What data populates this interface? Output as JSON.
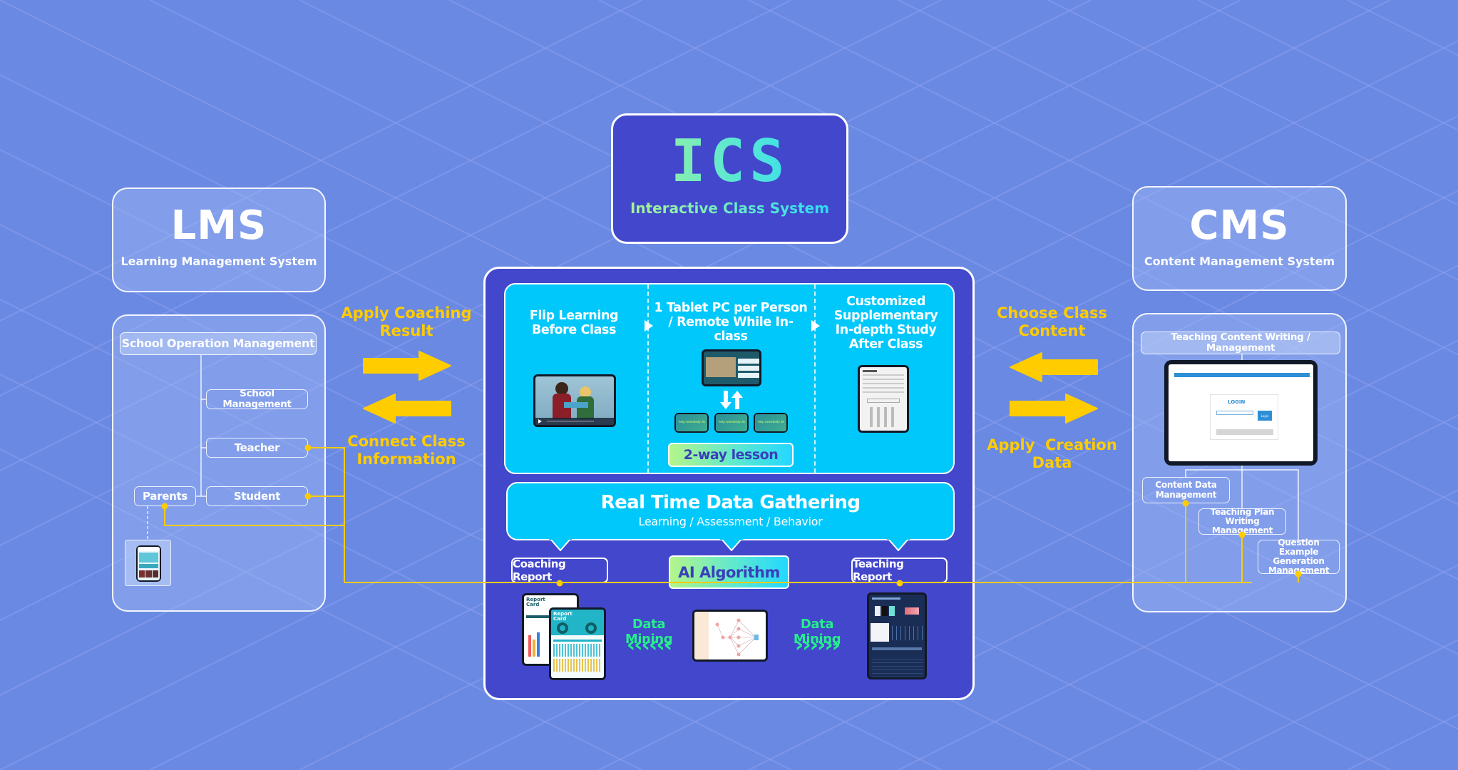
{
  "ics": {
    "title": "ICS",
    "subtitle": "Interactive Class System"
  },
  "lms": {
    "title": "LMS",
    "subtitle": "Learning Management System",
    "root_node": "School Operation Management",
    "nodes": {
      "school_management": "School Management",
      "teacher": "Teacher",
      "student": "Student",
      "parents": "Parents"
    }
  },
  "cms": {
    "title": "CMS",
    "subtitle": "Content Management System",
    "root_node": "Teaching Content Writing / Management",
    "nodes": {
      "content_data": "Content Data Management",
      "teaching_plan": "Teaching Plan Writing Management",
      "question_example": "Question Example Generation Management"
    },
    "login_screen": {
      "heading": "LOGIN",
      "button": "Login"
    }
  },
  "flows": {
    "left_top": "Apply Coaching Result",
    "left_bottom": "Connect Class Information",
    "right_top": "Choose Class Content",
    "right_bottom": "Apply  Creation Data"
  },
  "class_stages": [
    {
      "label": "Flip Learning Before Class"
    },
    {
      "label": "1 Tablet PC per Person / Remote While In-class"
    },
    {
      "label": "Customized Supplementary In-depth Study After Class"
    }
  ],
  "two_way_lesson": "2-way lesson",
  "tablet_prompt": "help somebody do",
  "data_gathering": {
    "title": "Real Time Data Gathering",
    "subtitle": "Learning / Assessment / Behavior"
  },
  "reports": {
    "coaching": "Coaching Report",
    "teaching": "Teaching Report",
    "ai": "AI Algorithm",
    "report_card": "Report Card"
  },
  "data_mining": {
    "left_label": "Data Mining",
    "right_label": "Data Mining",
    "left_chevrons": "‹‹‹‹‹‹",
    "right_chevrons": "››››››"
  },
  "colors": {
    "background": "#6a89e2",
    "panel_dark": "#4347cc",
    "cyan": "#00c8fb",
    "yellow": "#ffcc00",
    "green": "#25ef8a",
    "gradient_start": "#b4f58a",
    "gradient_end": "#22d8ff"
  }
}
